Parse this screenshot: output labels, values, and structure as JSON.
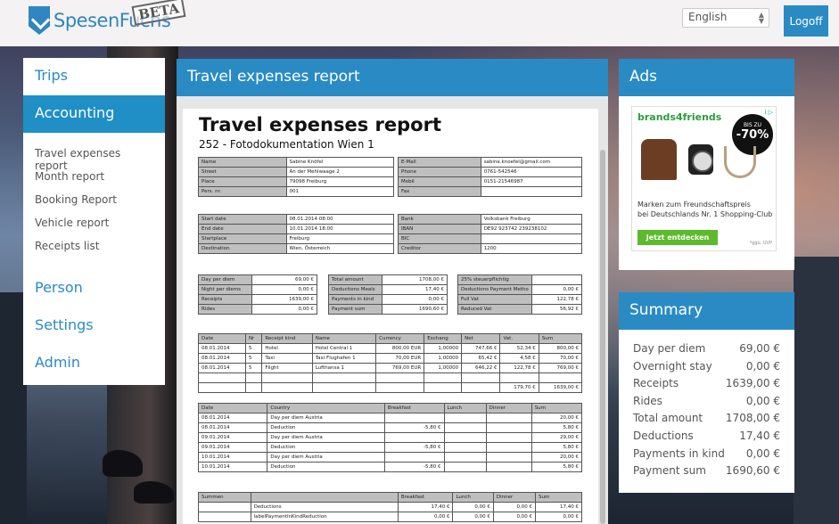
{
  "header": {
    "app_name": "SpesenFuchs",
    "beta": "BETA",
    "language": "English",
    "logoff": "Logoff"
  },
  "sidebar": {
    "main": [
      "Trips",
      "Accounting"
    ],
    "sub": [
      "Travel expenses report",
      "Month report",
      "Booking Report",
      "Vehicle report",
      "Receipts list"
    ],
    "bottom": [
      "Person",
      "Settings",
      "Admin"
    ]
  },
  "report": {
    "panel_title": "Travel expenses report",
    "title": "Travel expenses report",
    "subtitle": "252 - Fotodokumentation Wien 1",
    "person_left": [
      [
        "Name",
        "Sabine Knöfel"
      ],
      [
        "Street",
        "An der Mehlwaage 2"
      ],
      [
        "Place",
        "79098 Freiburg"
      ],
      [
        "Pers. nr.",
        "001"
      ]
    ],
    "person_right": [
      [
        "E-Mail",
        "sabine.knoefel@gmail.com"
      ],
      [
        "Phone",
        "0761-542546"
      ],
      [
        "Mobil",
        "0151-21546987"
      ],
      [
        "Fax",
        ""
      ]
    ],
    "trip_left": [
      [
        "Start date",
        "08.01.2014 08:00"
      ],
      [
        "End date",
        "10.01.2014 18:00"
      ],
      [
        "Startplace",
        "Freiburg"
      ],
      [
        "Destination",
        "Wien, Österreich"
      ]
    ],
    "trip_right": [
      [
        "Bank",
        "Volksbank Freiburg"
      ],
      [
        "IBAN",
        "DE92 923742 239238102"
      ],
      [
        "BIC",
        ""
      ],
      [
        "Creditor",
        "1200"
      ]
    ],
    "sum1": [
      [
        "Day per diem",
        "69,00 €"
      ],
      [
        "Night per diems",
        "0,00 €"
      ],
      [
        "Receipts",
        "1639,00 €"
      ],
      [
        "Rides",
        "0,00 €"
      ]
    ],
    "sum2": [
      [
        "Total amount",
        "1708,00 €"
      ],
      [
        "Deductions Meals",
        "17,40 €"
      ],
      [
        "Payments in kind",
        "0,00 €"
      ],
      [
        "Payment sum",
        "1690,60 €"
      ]
    ],
    "sum3": [
      [
        "25% steuerpflichtig",
        ""
      ],
      [
        "Deductions Payment Metho",
        "0,00 €"
      ],
      [
        "Full Vat",
        "122,78 €"
      ],
      [
        "Reduced Vat",
        "56,92 €"
      ]
    ],
    "receipts_head": [
      "Date",
      "Nr",
      "Receipt kind",
      "Name",
      "Currency",
      "Exchang",
      "Net",
      "Vat.",
      "Sum"
    ],
    "receipts": [
      [
        "08.01.2014",
        "5",
        "Hotel",
        "Hotel Central 1",
        "800,00 EUR",
        "1,00000",
        "747,66 €",
        "52,34 €",
        "800,00 €"
      ],
      [
        "08.01.2014",
        "5",
        "Taxi",
        "Taxi Flughafen 1",
        "70,00 EUR",
        "1,00000",
        "65,42 €",
        "4,58 €",
        "70,00 €"
      ],
      [
        "08.01.2014",
        "5",
        "Flight",
        "Lufthansa 1",
        "769,00 EUR",
        "1,00000",
        "646,22 €",
        "122,78 €",
        "769,00 €"
      ],
      [
        "",
        "",
        "",
        "",
        "",
        "",
        "",
        "",
        ""
      ],
      [
        "",
        "",
        "",
        "",
        "",
        "",
        "",
        "179,70 €",
        "1639,00 €"
      ]
    ],
    "diem_head": [
      "Date",
      "Country",
      "Breakfast",
      "Lunch",
      "Dinner",
      "Sum"
    ],
    "diems": [
      [
        "08.01.2014",
        "Day per diem Austria",
        "",
        "",
        "",
        "20,00 €"
      ],
      [
        "08.01.2014",
        "Deduction",
        "-5,80 €",
        "",
        "",
        "5,80 €"
      ],
      [
        "09.01.2014",
        "Day per diem Austria",
        "",
        "",
        "",
        "29,00 €"
      ],
      [
        "09.01.2014",
        "Deduction",
        "-5,80 €",
        "",
        "",
        "5,80 €"
      ],
      [
        "10.01.2014",
        "Day per diem Austria",
        "",
        "",
        "",
        "20,00 €"
      ],
      [
        "10.01.2014",
        "Deduction",
        "-5,80 €",
        "",
        "",
        "5,80 €"
      ]
    ],
    "totals_head": [
      "Summen",
      "",
      "Breakfast",
      "Lunch",
      "Dinner",
      "Sum"
    ],
    "totals": [
      [
        "",
        "Deductions",
        "17,40 €",
        "0,00 €",
        "0,00 €",
        "17,40 €"
      ],
      [
        "",
        "labelPaymentInKindReduction",
        "0,00 €",
        "0,00 €",
        "0,00 €",
        "0,00 €"
      ]
    ]
  },
  "ads": {
    "title": "Ads",
    "brand": "brands4friends",
    "badge_top": "BIS ZU",
    "badge_pct": "-70%",
    "line1": "Marken zum Freundschaftspreis",
    "line2": "bei Deutschlands Nr. 1 Shopping-Club",
    "button": "Jetzt entdecken",
    "foot": "*ggü. UVP",
    "info": "i ▷"
  },
  "summary": {
    "title": "Summary",
    "rows": [
      [
        "Day per diem",
        "69,00 €"
      ],
      [
        "Overnight stay",
        "0,00 €"
      ],
      [
        "Receipts",
        "1639,00 €"
      ],
      [
        "Rides",
        "0,00 €"
      ],
      [
        "Total amount",
        "1708,00 €"
      ],
      [
        "Deductions",
        "17,40 €"
      ],
      [
        "Payments in kind",
        "0,00 €"
      ],
      [
        "Payment sum",
        "1690,60 €"
      ]
    ]
  }
}
